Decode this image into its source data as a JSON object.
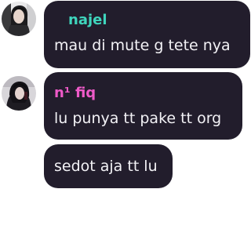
{
  "theme": {
    "bubble_bg": "#221d2c",
    "text_color": "#f3f2f6",
    "author_najel_color": "#3fd5bd",
    "author_fiq_color": "#ee5ac8"
  },
  "messages": [
    {
      "author": "najel",
      "text": "mau di mute g tete nya",
      "avatar_icon": "user-avatar-photo"
    },
    {
      "author": "n¹ fiq",
      "text": "lu punya tt pake tt org",
      "avatar_icon": "user-avatar-photo"
    },
    {
      "author": "",
      "text": "sedot aja tt lu",
      "avatar_icon": ""
    }
  ]
}
